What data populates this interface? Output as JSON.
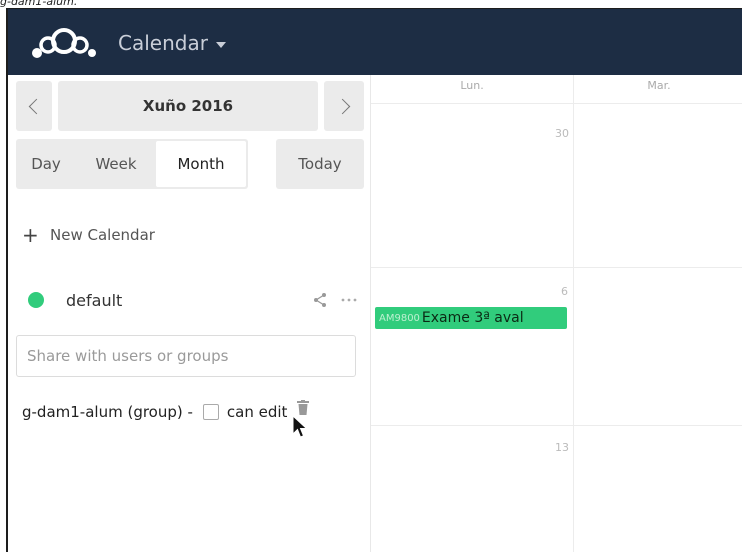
{
  "caption": "g-dam1-alum.",
  "header": {
    "app_name": "Calendar",
    "bg": "#1d2d44"
  },
  "nav": {
    "month_label": "Xuño 2016",
    "prev": "chevron-left-icon",
    "next": "chevron-right-icon"
  },
  "views": {
    "day": "Day",
    "week": "Week",
    "month": "Month",
    "today": "Today"
  },
  "new_calendar_label": "New Calendar",
  "calendar": {
    "name": "default",
    "color": "#31cc7c"
  },
  "share": {
    "placeholder": "Share with users or groups",
    "sharee": "g-dam1-alum (group) -",
    "can_edit_label": "can edit"
  },
  "grid": {
    "day_headers": [
      "Lun.",
      "Mar."
    ],
    "day_numbers": [
      "30",
      "6",
      "13"
    ]
  },
  "event": {
    "time": "AM9800",
    "title": "Exame 3ª aval"
  }
}
